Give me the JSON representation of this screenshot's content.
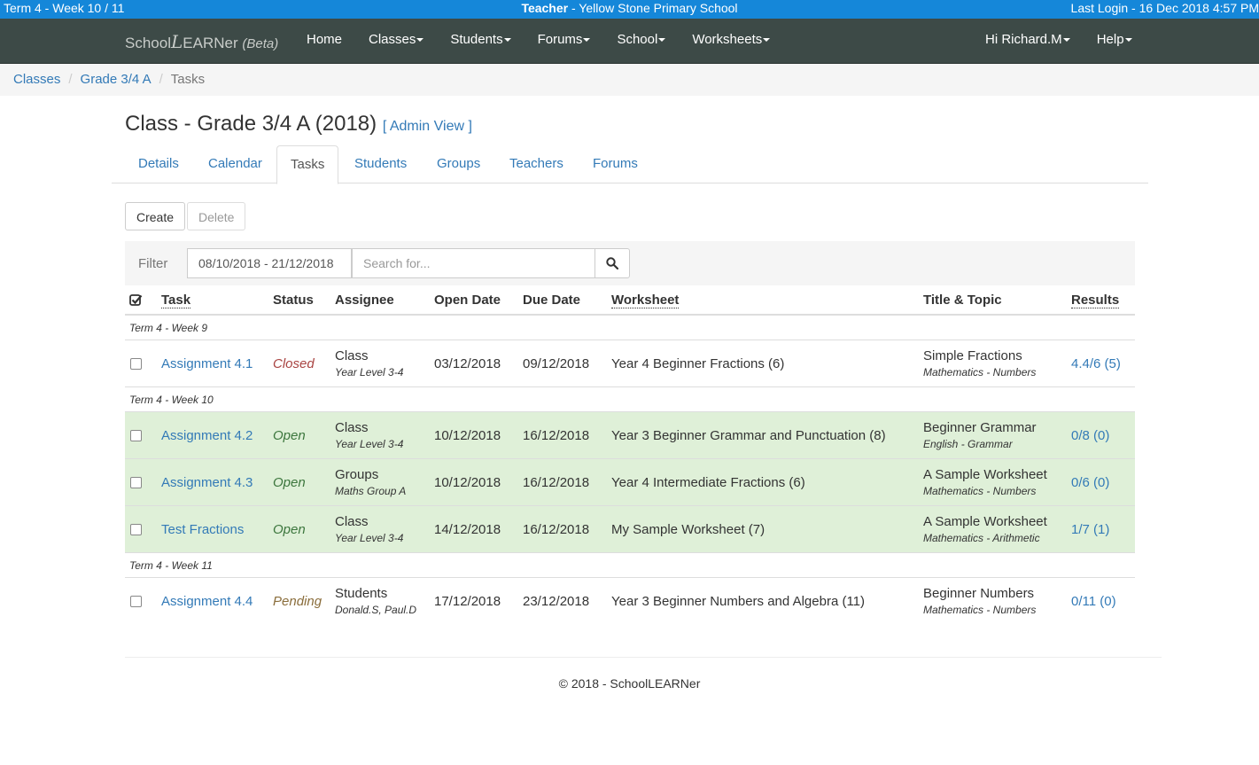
{
  "topbar": {
    "term": "Term 4 - Week 10 / 11",
    "role": "Teacher",
    "school": " - Yellow Stone Primary School",
    "last_login": "Last Login - 16 Dec 2018 4:57 PM"
  },
  "navbar": {
    "brand_school": "School",
    "brand_l": "L",
    "brand_earner": "EARNer",
    "brand_beta": "(Beta)",
    "items": [
      {
        "label": "Home",
        "dropdown": false
      },
      {
        "label": "Classes",
        "dropdown": true
      },
      {
        "label": "Students",
        "dropdown": true
      },
      {
        "label": "Forums",
        "dropdown": true
      },
      {
        "label": "School",
        "dropdown": true
      },
      {
        "label": "Worksheets",
        "dropdown": true
      }
    ],
    "user": "Hi Richard.M",
    "help": "Help"
  },
  "breadcrumb": {
    "items": [
      "Classes",
      "Grade 3/4 A"
    ],
    "current": "Tasks"
  },
  "page": {
    "title": "Class - Grade 3/4 A (2018)",
    "admin_open": "[",
    "admin_view": "Admin View",
    "admin_close": "]"
  },
  "tabs": [
    "Details",
    "Calendar",
    "Tasks",
    "Students",
    "Groups",
    "Teachers",
    "Forums"
  ],
  "actions": {
    "create": "Create",
    "delete": "Delete"
  },
  "filter": {
    "label": "Filter",
    "date_range": "08/10/2018 - 21/12/2018",
    "search_placeholder": "Search for..."
  },
  "table": {
    "headers": [
      "Task",
      "Status",
      "Assignee",
      "Open Date",
      "Due Date",
      "Worksheet",
      "Title & Topic",
      "Results"
    ],
    "groups": [
      {
        "label": "Term 4 - Week 9",
        "rows": [
          {
            "task": "Assignment 4.1",
            "status": "Closed",
            "assignee": "Class",
            "assignee_sub": "Year Level 3-4",
            "open": "03/12/2018",
            "due": "09/12/2018",
            "worksheet": "Year 4 Beginner Fractions (6)",
            "title": "Simple Fractions",
            "topic": "Mathematics - Numbers",
            "results": "4.4/6 (5)"
          }
        ]
      },
      {
        "label": "Term 4 - Week 10",
        "rows": [
          {
            "task": "Assignment 4.2",
            "status": "Open",
            "assignee": "Class",
            "assignee_sub": "Year Level 3-4",
            "open": "10/12/2018",
            "due": "16/12/2018",
            "worksheet": "Year 3 Beginner Grammar and Punctuation (8)",
            "title": "Beginner Grammar",
            "topic": "English - Grammar",
            "results": "0/8 (0)"
          },
          {
            "task": "Assignment 4.3",
            "status": "Open",
            "assignee": "Groups",
            "assignee_sub": "Maths Group A",
            "open": "10/12/2018",
            "due": "16/12/2018",
            "worksheet": "Year 4 Intermediate Fractions (6)",
            "title": "A Sample Worksheet",
            "topic": "Mathematics - Numbers",
            "results": "0/6 (0)"
          },
          {
            "task": "Test Fractions",
            "status": "Open",
            "assignee": "Class",
            "assignee_sub": "Year Level 3-4",
            "open": "14/12/2018",
            "due": "16/12/2018",
            "worksheet": "My Sample Worksheet (7)",
            "title": "A Sample Worksheet",
            "topic": "Mathematics - Arithmetic",
            "results": "1/7 (1)"
          }
        ]
      },
      {
        "label": "Term 4 - Week 11",
        "rows": [
          {
            "task": "Assignment 4.4",
            "status": "Pending",
            "assignee": "Students",
            "assignee_sub": "Donald.S, Paul.D",
            "open": "17/12/2018",
            "due": "23/12/2018",
            "worksheet": "Year 3 Beginner Numbers and Algebra (11)",
            "title": "Beginner Numbers",
            "topic": "Mathematics - Numbers",
            "results": "0/11 (0)"
          }
        ]
      }
    ]
  },
  "footer": "© 2018 - SchoolLEARNer"
}
